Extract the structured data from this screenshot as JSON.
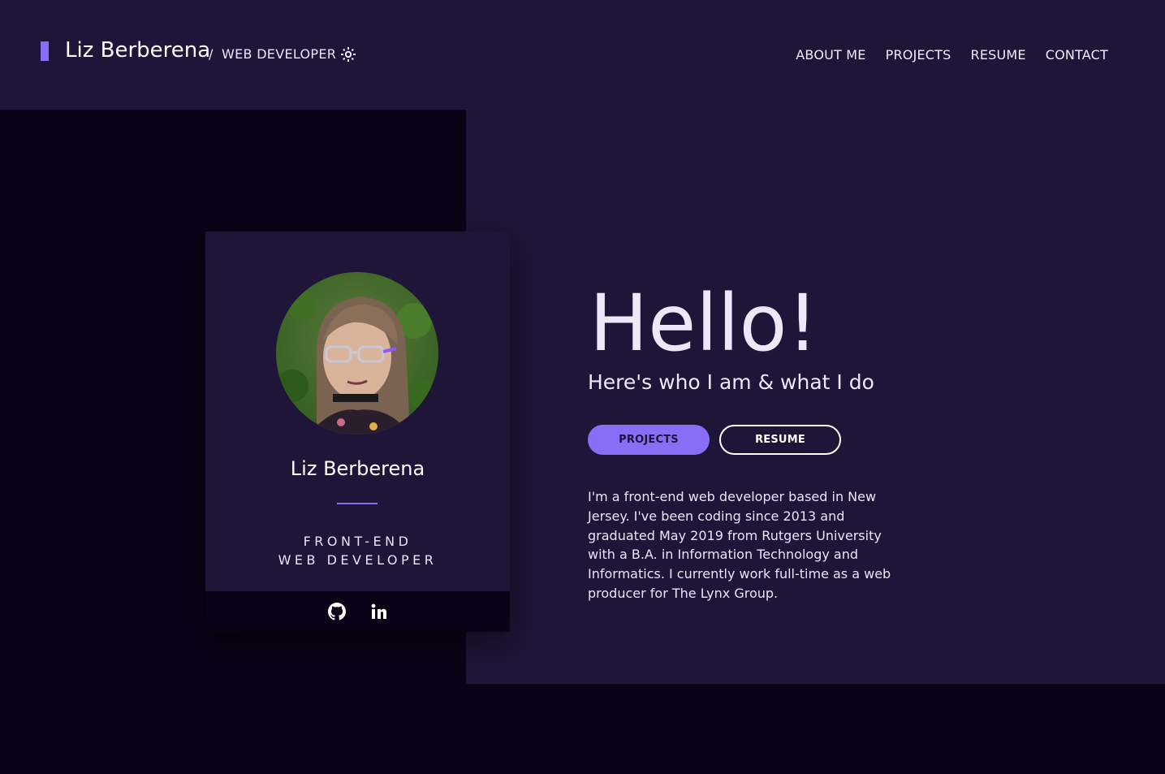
{
  "header": {
    "brand_name": "Liz Berberena",
    "separator": "/",
    "role": "WEB DEVELOPER",
    "theme_toggle_icon": "sun-icon",
    "accent_color": "#8b6cf6",
    "nav": [
      {
        "label": "ABOUT ME"
      },
      {
        "label": "PROJECTS"
      },
      {
        "label": "RESUME"
      },
      {
        "label": "CONTACT"
      }
    ]
  },
  "card": {
    "avatar_icon": "avatar",
    "name": "Liz Berberena",
    "title_line1": "FRONT-END",
    "title_line2": "WEB DEVELOPER",
    "social": [
      {
        "icon": "github-icon"
      },
      {
        "icon": "linkedin-icon"
      }
    ]
  },
  "hero": {
    "greeting": "Hello!",
    "subtitle": "Here's who I am & what I do",
    "primary_button": "PROJECTS",
    "secondary_button": "RESUME",
    "bio": "I'm a front-end web developer based in New Jersey. I've been coding since 2013 and graduated May 2019 from Rutgers University with a B.A. in Information Technology and Informatics. I currently work full-time as a web producer for The Lynx Group."
  },
  "colors": {
    "background": "#0a0318",
    "panel": "#1f1538",
    "accent": "#8b6cf6",
    "text": "#ece8f7"
  }
}
